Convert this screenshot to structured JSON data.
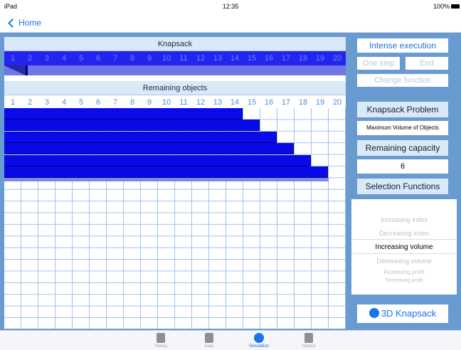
{
  "status": {
    "device": "iPad",
    "time": "12:35",
    "battery": "100%"
  },
  "nav": {
    "back_label": "Home"
  },
  "knapsack": {
    "title": "Knapsack",
    "numbers": [
      "1",
      "2",
      "3",
      "4",
      "5",
      "6",
      "7",
      "8",
      "9",
      "10",
      "11",
      "12",
      "13",
      "14",
      "15",
      "16",
      "17",
      "18",
      "19",
      "20"
    ]
  },
  "objects": {
    "title": "Remaining objects",
    "numbers": [
      "1",
      "2",
      "3",
      "4",
      "5",
      "6",
      "7",
      "8",
      "9",
      "10",
      "11",
      "12",
      "13",
      "14",
      "15",
      "16",
      "17",
      "18",
      "19",
      "20"
    ],
    "bar_lengths": [
      14,
      15,
      16,
      17,
      18,
      19
    ]
  },
  "panel": {
    "intense_execution": "Intense execution",
    "one_step": "One step",
    "end": "End",
    "change_function": "Change function",
    "problem_title": "Knapsack Problem",
    "problem_value": "Maximum Volume of Objects",
    "capacity_title": "Remaining capacity",
    "capacity_value": "6",
    "functions_title": "Selection Functions",
    "functions": [
      "Increasing index",
      "Decreasing index",
      "Increasing volume",
      "Decreasing volume",
      "Increasing profit",
      "Decreasing profit"
    ],
    "selected_function": "Increasing volume",
    "knapsack3d": "3D Knapsack"
  },
  "tabs": [
    {
      "label": "Theory",
      "icon": "document-icon"
    },
    {
      "label": "Data",
      "icon": "chart-icon"
    },
    {
      "label": "Simulation",
      "icon": "gear-icon"
    },
    {
      "label": "History",
      "icon": "book-icon"
    }
  ],
  "colors": {
    "accent": "#1a73e8",
    "object_bar": "#0a0ae8",
    "knapsack_bar": "#2424ee",
    "background": "#6a9bd0"
  }
}
